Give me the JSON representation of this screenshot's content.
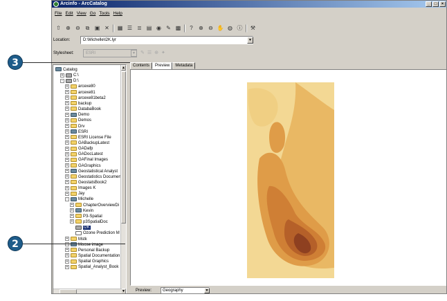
{
  "window": {
    "title": "Arcinfo - ArcCatalog"
  },
  "menu": [
    "File",
    "Edit",
    "View",
    "Go",
    "Tools",
    "Help"
  ],
  "toolbar": {
    "icons": [
      "up-one-level-icon",
      "connect-folder-icon",
      "disconnect-folder-icon",
      "copy-icon",
      "paste-icon",
      "delete-icon",
      "large-icons-icon",
      "list-icon",
      "details-icon",
      "thumbnails-icon",
      "launch-arcmap-icon",
      "metadata-icon",
      "properties-icon",
      "whats-this-icon",
      "zoom-in-icon",
      "zoom-out-icon",
      "pan-icon",
      "full-extent-icon",
      "identify-icon",
      "arctoolbox-icon"
    ]
  },
  "location": {
    "label": "Location:",
    "value": "D:\\Michelle\\l2K.lyr"
  },
  "stylesheet": {
    "label": "Stylesheet:",
    "value": "ESRI"
  },
  "tabs": [
    {
      "label": "Contents",
      "active": false
    },
    {
      "label": "Preview",
      "active": true
    },
    {
      "label": "Metadata",
      "active": false
    }
  ],
  "tree": [
    {
      "label": "Catalog",
      "depth": 0,
      "toggle": "",
      "icon": "catalog-icon"
    },
    {
      "label": "C:\\",
      "depth": 1,
      "toggle": "+",
      "icon": "drive-icon"
    },
    {
      "label": "D:\\",
      "depth": 1,
      "toggle": "-",
      "icon": "drive-icon"
    },
    {
      "label": "arcexe80",
      "depth": 2,
      "toggle": "+",
      "icon": "folder-icon"
    },
    {
      "label": "arcexe81",
      "depth": 2,
      "toggle": "+",
      "icon": "folder-icon"
    },
    {
      "label": "arcexe81beta2",
      "depth": 2,
      "toggle": "+",
      "icon": "folder-icon"
    },
    {
      "label": "backup",
      "depth": 2,
      "toggle": "+",
      "icon": "folder-icon"
    },
    {
      "label": "DatabaBook",
      "depth": 2,
      "toggle": "+",
      "icon": "folder-icon"
    },
    {
      "label": "Demo",
      "depth": 2,
      "toggle": "+",
      "icon": "database-icon"
    },
    {
      "label": "Demos",
      "depth": 2,
      "toggle": "+",
      "icon": "folder-icon"
    },
    {
      "label": "Drv",
      "depth": 2,
      "toggle": "+",
      "icon": "folder-icon"
    },
    {
      "label": "ESRI",
      "depth": 2,
      "toggle": "+",
      "icon": "database-icon"
    },
    {
      "label": "ESRI License File",
      "depth": 2,
      "toggle": "+",
      "icon": "folder-icon"
    },
    {
      "label": "GABackupLatest",
      "depth": 2,
      "toggle": "+",
      "icon": "folder-icon"
    },
    {
      "label": "GADafp",
      "depth": 2,
      "toggle": "+",
      "icon": "folder-icon"
    },
    {
      "label": "GADocLatest",
      "depth": 2,
      "toggle": "+",
      "icon": "folder-icon"
    },
    {
      "label": "GAFinal Images",
      "depth": 2,
      "toggle": "+",
      "icon": "folder-icon"
    },
    {
      "label": "GAGraphics",
      "depth": 2,
      "toggle": "+",
      "icon": "folder-icon"
    },
    {
      "label": "Geostatistical Analyst",
      "depth": 2,
      "toggle": "+",
      "icon": "database-icon"
    },
    {
      "label": "Geostatistics Document",
      "depth": 2,
      "toggle": "+",
      "icon": "folder-icon"
    },
    {
      "label": "GeostatsBook2",
      "depth": 2,
      "toggle": "+",
      "icon": "folder-icon"
    },
    {
      "label": "Images K",
      "depth": 2,
      "toggle": "+",
      "icon": "folder-icon"
    },
    {
      "label": "Jay",
      "depth": 2,
      "toggle": "+",
      "icon": "folder-icon"
    },
    {
      "label": "Michelle",
      "depth": 2,
      "toggle": "-",
      "icon": "database-icon"
    },
    {
      "label": "ChapterOverviewDi",
      "depth": 3,
      "toggle": "+",
      "icon": "folder-icon"
    },
    {
      "label": "Kevin",
      "depth": 3,
      "toggle": "+",
      "icon": "database-icon"
    },
    {
      "label": "P3-Spatial",
      "depth": 3,
      "toggle": "+",
      "icon": "folder-icon"
    },
    {
      "label": "p3SpatialDoc",
      "depth": 3,
      "toggle": "+",
      "icon": "folder-icon"
    },
    {
      "label": "l2K",
      "depth": 3,
      "toggle": "",
      "icon": "grid-icon",
      "selected": true
    },
    {
      "label": "Ozone Prediction M",
      "depth": 3,
      "toggle": "",
      "icon": "document-icon"
    },
    {
      "label": "Mstk",
      "depth": 2,
      "toggle": "+",
      "icon": "folder-icon"
    },
    {
      "label": "Moose image",
      "depth": 2,
      "toggle": "+",
      "icon": "database-icon"
    },
    {
      "label": "Personal Backup",
      "depth": 2,
      "toggle": "+",
      "icon": "folder-icon"
    },
    {
      "label": "Spatial Documentation",
      "depth": 2,
      "toggle": "+",
      "icon": "folder-icon"
    },
    {
      "label": "Spatial Graphics",
      "depth": 2,
      "toggle": "+",
      "icon": "folder-icon"
    },
    {
      "label": "Spatial_Analyst_Book",
      "depth": 2,
      "toggle": "+",
      "icon": "folder-icon"
    }
  ],
  "preview": {
    "label": "Preview:",
    "value": "Geography",
    "map_colors": [
      "#f6e2a8",
      "#f0cf83",
      "#e9b864",
      "#df9c48",
      "#cf7f35",
      "#b56029",
      "#8e4020"
    ]
  },
  "callouts": [
    {
      "number": "3"
    },
    {
      "number": "2"
    }
  ]
}
